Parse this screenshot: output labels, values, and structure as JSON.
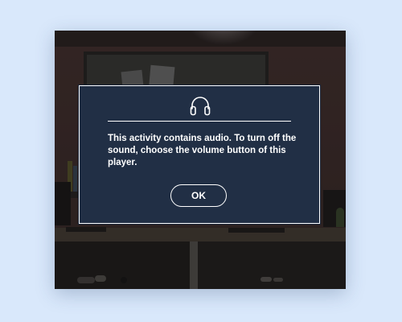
{
  "dialog": {
    "icon": "headphones-icon",
    "message": "This activity contains audio. To turn off the sound, choose the volume button of this player.",
    "ok_label": "OK"
  },
  "colors": {
    "page_background": "#d9e8fb",
    "dialog_background": "#212f45",
    "dialog_border": "#ffffff",
    "text": "#ffffff"
  }
}
